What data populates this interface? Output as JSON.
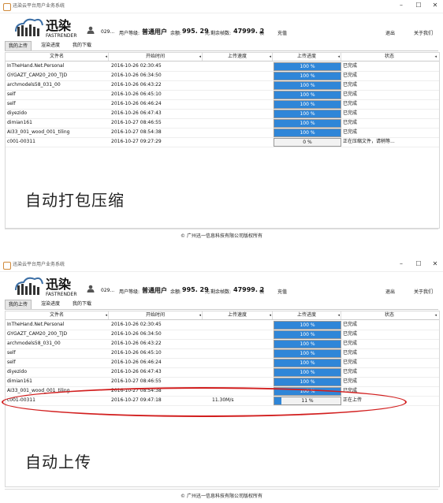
{
  "panels": [
    {
      "window_title": "迅染云平台用户业务系统",
      "user_id": "029...",
      "user_level_label": "用户等级:",
      "user_level_value": "普通用户",
      "balance_label": "余额:",
      "balance_value": "995. 29",
      "balance_unit": "元",
      "frames_label": "剩余帧数:",
      "frames_value": "47999. 2",
      "frames_unit": "帧",
      "recharge": "充值",
      "logout": "退出",
      "about": "关于我们",
      "tabs": [
        "我的上传",
        "渲染进度",
        "我的下载"
      ],
      "columns": [
        "文件名",
        "开始时间",
        "上传速度",
        "上传进度",
        "状态"
      ],
      "rows": [
        {
          "name": "InTheHand.Net.Personal",
          "time": "2016-10-26 02:30:45",
          "speed": "",
          "progress": 100,
          "progress_text": "100 %",
          "status": "已完成"
        },
        {
          "name": "GYGAZT_CAM20_200_TJD",
          "time": "2016-10-26 06:34:50",
          "speed": "",
          "progress": 100,
          "progress_text": "100 %",
          "status": "已完成"
        },
        {
          "name": "archmodels58_031_00",
          "time": "2016-10-26 06:43:22",
          "speed": "",
          "progress": 100,
          "progress_text": "100 %",
          "status": "已完成"
        },
        {
          "name": "self",
          "time": "2016-10-26 06:45:10",
          "speed": "",
          "progress": 100,
          "progress_text": "100 %",
          "status": "已完成"
        },
        {
          "name": "self",
          "time": "2016-10-26 06:46:24",
          "speed": "",
          "progress": 100,
          "progress_text": "100 %",
          "status": "已完成"
        },
        {
          "name": "diyezido",
          "time": "2016-10-26 06:47:43",
          "speed": "",
          "progress": 100,
          "progress_text": "100 %",
          "status": "已完成"
        },
        {
          "name": "dimian161",
          "time": "2016-10-27 08:46:55",
          "speed": "",
          "progress": 100,
          "progress_text": "100 %",
          "status": "已完成"
        },
        {
          "name": "AI33_001_wood_001_tiling",
          "time": "2016-10-27 08:54:38",
          "speed": "",
          "progress": 100,
          "progress_text": "100 %",
          "status": "已完成"
        },
        {
          "name": "c001-00311",
          "time": "2016-10-27 09:27:29",
          "speed": "",
          "progress": 0,
          "progress_text": "0 %",
          "status": "正在压缩文件，请稍等..."
        }
      ],
      "caption": "自动打包压缩",
      "footer": "© 广州迅一信息科技有限公司版权所有"
    },
    {
      "window_title": "迅染云平台用户业务系统",
      "user_id": "029...",
      "user_level_label": "用户等级:",
      "user_level_value": "普通用户",
      "balance_label": "余额:",
      "balance_value": "995. 29",
      "balance_unit": "元",
      "frames_label": "剩余帧数:",
      "frames_value": "47999. 2",
      "frames_unit": "帧",
      "recharge": "充值",
      "logout": "退出",
      "about": "关于我们",
      "tabs": [
        "我的上传",
        "渲染进度",
        "我的下载"
      ],
      "columns": [
        "文件名",
        "开始时间",
        "上传速度",
        "上传进度",
        "状态"
      ],
      "rows": [
        {
          "name": "InTheHand.Net.Personal",
          "time": "2016-10-26 02:30:45",
          "speed": "",
          "progress": 100,
          "progress_text": "100 %",
          "status": "已完成"
        },
        {
          "name": "GYGAZT_CAM20_200_TJD",
          "time": "2016-10-26 06:34:50",
          "speed": "",
          "progress": 100,
          "progress_text": "100 %",
          "status": "已完成"
        },
        {
          "name": "archmodels58_031_00",
          "time": "2016-10-26 06:43:22",
          "speed": "",
          "progress": 100,
          "progress_text": "100 %",
          "status": "已完成"
        },
        {
          "name": "self",
          "time": "2016-10-26 06:45:10",
          "speed": "",
          "progress": 100,
          "progress_text": "100 %",
          "status": "已完成"
        },
        {
          "name": "self",
          "time": "2016-10-26 06:46:24",
          "speed": "",
          "progress": 100,
          "progress_text": "100 %",
          "status": "已完成"
        },
        {
          "name": "diyezido",
          "time": "2016-10-26 06:47:43",
          "speed": "",
          "progress": 100,
          "progress_text": "100 %",
          "status": "已完成"
        },
        {
          "name": "dimian161",
          "time": "2016-10-27 08:46:55",
          "speed": "",
          "progress": 100,
          "progress_text": "100 %",
          "status": "已完成"
        },
        {
          "name": "AI33_001_wood_001_tiling",
          "time": "2016-10-27 08:54:38",
          "speed": "",
          "progress": 100,
          "progress_text": "100 %",
          "status": "已完成"
        },
        {
          "name": "c001-00311",
          "time": "2016-10-27 09:47:18",
          "speed": "11.30M/s",
          "progress": 11,
          "progress_text": "11 %",
          "status": "正在上传"
        }
      ],
      "caption": "自动上传",
      "footer": "© 广州迅一信息科技有限公司版权所有"
    }
  ],
  "colors": {
    "progress_fill": "#2f86d8",
    "highlight": "#d21f1f",
    "logo_blue": "#3b6ea5"
  }
}
